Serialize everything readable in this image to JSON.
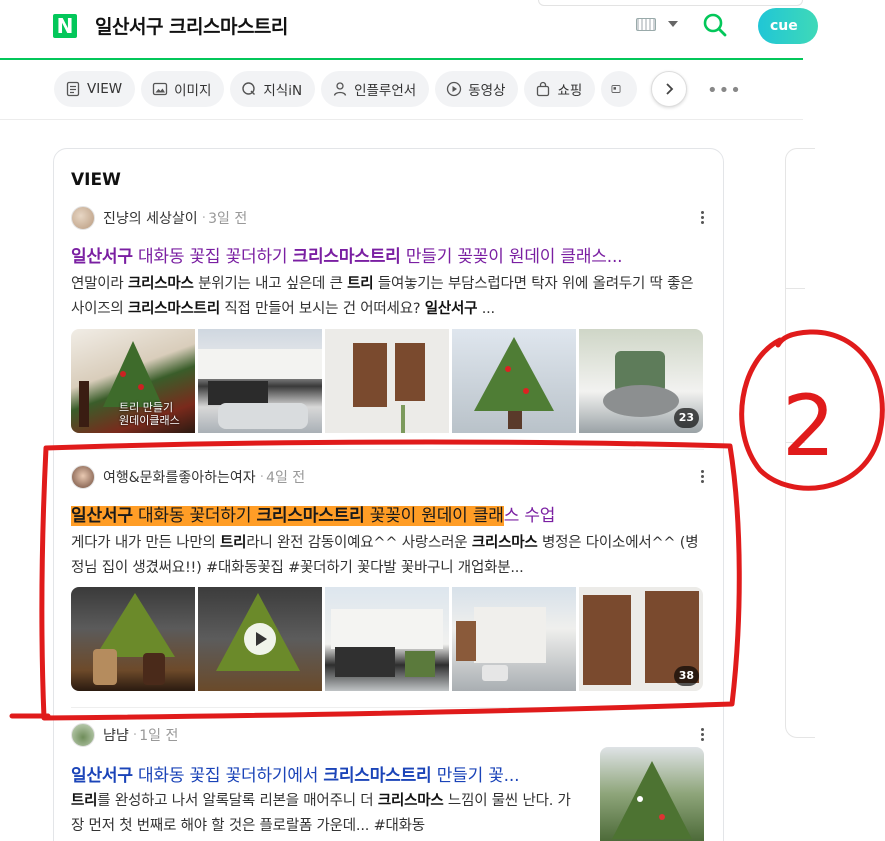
{
  "search": {
    "query": "일산서구 크리스마스트리",
    "logo": "N",
    "cue_label": "cue",
    "icons": [
      "keyboard-icon",
      "search-icon"
    ],
    "brand_color": "#03c75a"
  },
  "tabs": [
    {
      "label": "VIEW",
      "icon": "document-icon"
    },
    {
      "label": "이미지",
      "icon": "image-icon"
    },
    {
      "label": "지식iN",
      "icon": "qa-icon"
    },
    {
      "label": "인플루언서",
      "icon": "person-icon"
    },
    {
      "label": "동영상",
      "icon": "play-icon"
    },
    {
      "label": "쇼핑",
      "icon": "bag-icon"
    }
  ],
  "section": {
    "title": "VIEW"
  },
  "posts": [
    {
      "author": "진냥의 세상살이",
      "time": "3일 전",
      "title_parts": [
        "일산서구",
        " 대화동 꽃집 꽃더하기 ",
        "크리스마스트리",
        " 만들기 꽂꽂이 원데이 클래스..."
      ],
      "desc_parts": [
        "연말이라 ",
        "크리스마스",
        " 분위기는 내고 싶은데 큰 ",
        "트리",
        " 들여놓기는 부담스럽다면 탁자 위에 올려두기 딱 좋은 사이즈의 ",
        "크리스마스트리",
        " 직접 만들어 보시는 건 어떠세요? ",
        "일산서구",
        " ..."
      ],
      "image_overlay": "트리 만들기\n원데이클래스",
      "image_count": "23"
    },
    {
      "author": "여행&문화를좋아하는여자",
      "time": "4일 전",
      "title_parts": [
        "일산서구",
        " 대화동 꽃더하기 ",
        "크리스마스트리",
        " 꽃꽂이 원데이 클래",
        "스 수업"
      ],
      "desc_parts": [
        "게다가 내가 만든 나만의 ",
        "트리",
        "라니 완전 감동이예요^^ 사랑스러운 ",
        "크리스마스",
        " 병정은 다이소에서^^ (병정님 집이 생겼써요!!) #대화동꽃집 #꽃더하기 꽃다발 꽃바구니 개업화분..."
      ],
      "image_count": "38"
    },
    {
      "author": "냠냠",
      "time": "1일 전",
      "title_parts": [
        "일산서구",
        " 대화동 꽃집 꽃더하기에서 ",
        "크리스마스트리",
        " 만들기 꽃..."
      ],
      "desc_parts": [
        "트리",
        "를 완성하고 나서 알록달록 리본을 매어주니 더 ",
        "크리스마스",
        " 느낌이 물씬 난다. 가장 먼저 첫 번째로 해야 할 것은 플로랄폼 가운데... #대화동"
      ]
    }
  ],
  "annotation": {
    "label": "2",
    "color": "#e01b1b"
  }
}
